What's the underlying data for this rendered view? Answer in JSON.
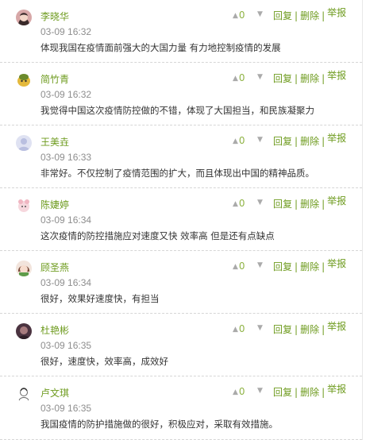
{
  "comments": [
    {
      "user": "李晓华",
      "time": "03-09 16:32",
      "text": "体现我国在疫情面前强大的大国力量 有力地控制疫情的发展",
      "likes": "0",
      "avatar_icon": "avatar-girl-dark-hair",
      "avatar_color": "#c98b8f"
    },
    {
      "user": "简竹青",
      "time": "03-09 16:32",
      "text": "我觉得中国这次疫情防控做的不错，体现了大国担当，和民族凝聚力",
      "likes": "0",
      "avatar_icon": "avatar-yellow-cartoon",
      "avatar_color": "#e4b93c"
    },
    {
      "user": "王美垚",
      "time": "03-09 16:33",
      "text": "非常好。不仅控制了疫情范围的扩大，而且体现出中国的精神品质。",
      "likes": "0",
      "avatar_icon": "avatar-default-person",
      "avatar_color": "#c6cbe6"
    },
    {
      "user": "陈婕婷",
      "time": "03-09 16:34",
      "text": "这次疫情的防控措施应对速度又快 效率高 但是还有点缺点",
      "likes": "0",
      "avatar_icon": "avatar-pink-cartoon",
      "avatar_color": "#f0c4cc"
    },
    {
      "user": "顾圣燕",
      "time": "03-09 16:34",
      "text": "很好，效果好速度快，有担当",
      "likes": "0",
      "avatar_icon": "avatar-cartoon-girl",
      "avatar_color": "#e2b8b0"
    },
    {
      "user": "杜艳彬",
      "time": "03-09 16:35",
      "text": "很好，速度快，效率高，成效好",
      "likes": "0",
      "avatar_icon": "avatar-dark-photo",
      "avatar_color": "#6b4a5a"
    },
    {
      "user": "卢文琪",
      "time": "03-09 16:35",
      "text": "我国疫情的防护措施做的很好，积极应对，采取有效措施。",
      "likes": "0",
      "avatar_icon": "avatar-sketch",
      "avatar_color": "#e8e8e8"
    }
  ],
  "actions": {
    "reply": "回复",
    "delete": "删除",
    "report": "举报",
    "separator": "|"
  },
  "colors": {
    "accent": "#6e9b1e",
    "timestamp": "#8e8e8e",
    "like": "#8fb344"
  }
}
